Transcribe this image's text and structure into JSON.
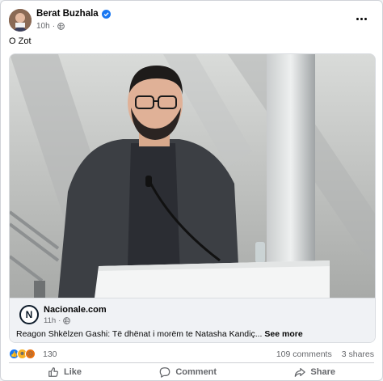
{
  "post": {
    "author": "Berat Buzhala",
    "time": "10h",
    "caption": "O Zot"
  },
  "shared": {
    "source_name": "Nacionale.com",
    "source_logo_letter": "N",
    "source_time": "11h",
    "headline": "Reagon Shkëlzen Gashi: Të dhënat i morëm te Natasha Kandiç...",
    "see_more": "See more"
  },
  "reactions": {
    "count": "130",
    "comments": "109 comments",
    "shares": "3 shares"
  },
  "actions": {
    "like": "Like",
    "comment": "Comment",
    "share": "Share"
  },
  "colors": {
    "like_blue": "#1877f2",
    "love_red": "#f33e58",
    "haha_yellow": "#f7b125",
    "angry_orange": "#e9710f"
  }
}
